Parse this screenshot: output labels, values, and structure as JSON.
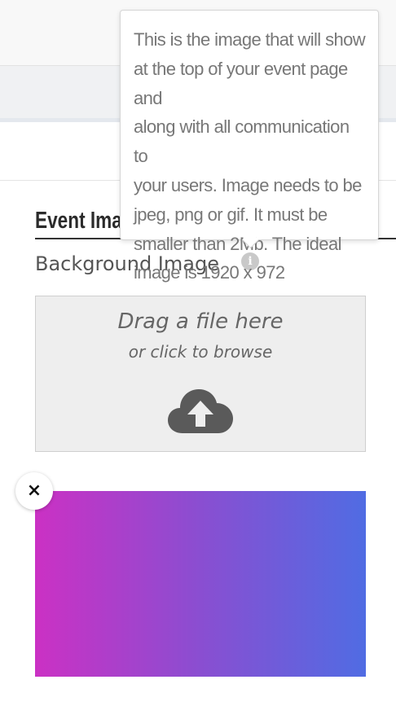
{
  "section": {
    "title": "Event Image"
  },
  "field": {
    "label": "Background Image",
    "info_icon": "info-icon"
  },
  "tooltip": {
    "lines": [
      "This is the image that will show",
      "at the top of your event page and",
      "along with all communication to",
      "your users. Image needs to be",
      "jpeg, png or gif. It must be",
      "smaller than 2Mb. The ideal",
      "image is 1920 x 972"
    ]
  },
  "dropzone": {
    "title": "Drag a file here",
    "subtitle": "or click to browse",
    "icon": "cloud-upload-icon"
  },
  "preview": {
    "remove_icon": "close-icon",
    "remove_label": "×",
    "gradient_start": "#cb31c4",
    "gradient_end": "#506ce3"
  },
  "colors": {
    "text_dark": "#2b2b2b",
    "text_muted": "#555555",
    "dropzone_bg": "#eeeeee"
  }
}
